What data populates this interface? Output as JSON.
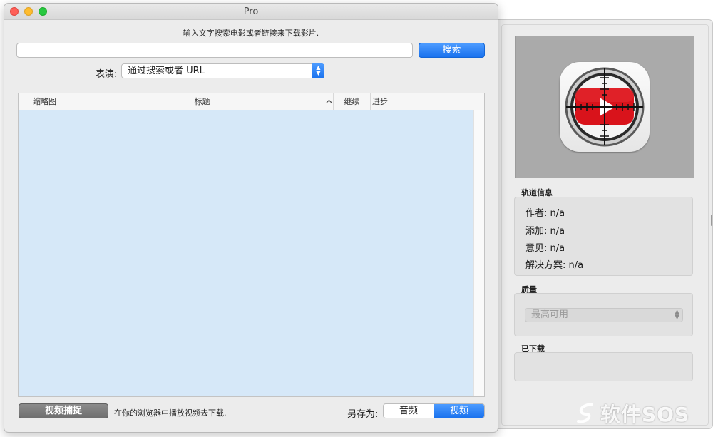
{
  "window": {
    "title": "Pro"
  },
  "search": {
    "instruction": "输入文字搜索电影或者链接来下载影片.",
    "value": "",
    "placeholder": "",
    "button_label": "搜索"
  },
  "show": {
    "label": "表演:",
    "selected": "通过搜索或者 URL"
  },
  "table": {
    "columns": [
      "缩略图",
      "标题",
      "继续",
      "进步"
    ],
    "rows": []
  },
  "bottom": {
    "capture_label": "视频捕捉",
    "hint": "在你的浏览器中播放视频去下载.",
    "save_as_label": "另存为:",
    "options": [
      "音频",
      "视频"
    ],
    "selected_option": "视频"
  },
  "drawer": {
    "track_info_title": "轨道信息",
    "track_info": {
      "author": "作者: n/a",
      "added": "添加: n/a",
      "comments": "意见: n/a",
      "resolution": "解决方案: n/a"
    },
    "quality_title": "质量",
    "quality_selected": "最高可用",
    "downloaded_title": "已下载"
  },
  "watermark": {
    "text": "软件SOS"
  },
  "colors": {
    "accent": "#1a72ee",
    "table_bg": "#d6e8f8",
    "icon_red": "#d9131b"
  }
}
